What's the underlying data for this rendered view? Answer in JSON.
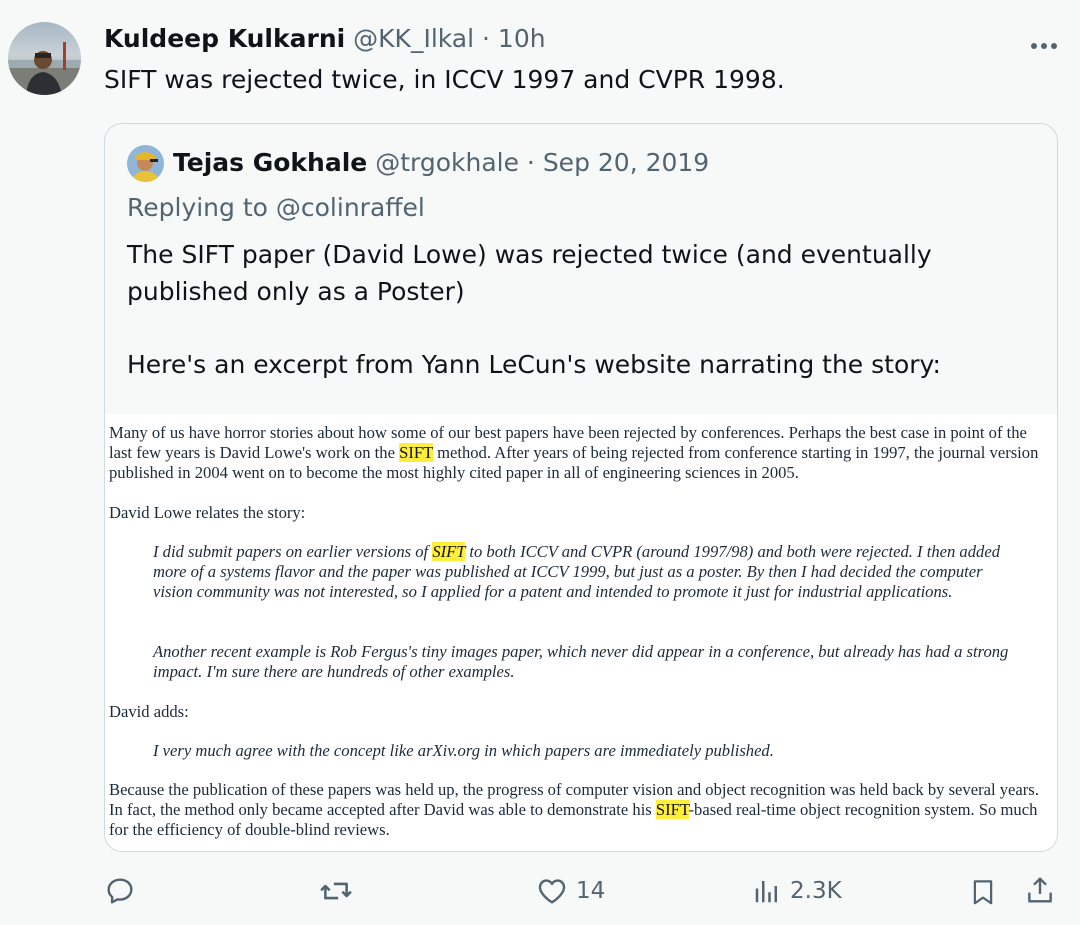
{
  "tweet": {
    "author_name": "Kuldeep Kulkarni",
    "author_handle": "@KK_Ilkal",
    "separator": " · ",
    "time": "10h",
    "text": "SIFT was rejected twice, in ICCV 1997 and CVPR 1998.",
    "more_icon": "more-horizontal-icon"
  },
  "quote": {
    "author_name": "Tejas Gokhale",
    "author_handle": "@trgokhale",
    "separator": " · ",
    "date": "Sep 20, 2019",
    "replying_prefix": "Replying to ",
    "replying_to": "@colinraffel",
    "paragraphs": [
      "The SIFT paper (David Lowe) was rejected twice (and eventually published only as a Poster)",
      "Here's an excerpt from Yann LeCun's website narrating the story:"
    ]
  },
  "excerpt": {
    "highlight_color": "#ffef3a",
    "p1_before": "Many of us have horror stories about how some of our best papers have been rejected by conferences. Perhaps the best case in point of the last few years is David Lowe's work on the ",
    "p1_hl": "SIFT",
    "p1_after": " method. After years of being rejected from conference starting in 1997, the journal version published in 2004 went on to become the most highly cited paper in all of engineering sciences in 2005.",
    "p2": "David Lowe relates the story:",
    "p3_before": "I did submit papers on earlier versions of ",
    "p3_hl": "SIFT",
    "p3_after": " to both ICCV and CVPR (around 1997/98) and both were rejected. I then added more of a systems flavor and the paper was published at ICCV 1999, but just as a poster. By then I had decided the computer vision community was not interested, so I applied for a patent and intended to promote it just for industrial applications.",
    "p4": "Another recent example is Rob Fergus's tiny images paper, which never did appear in a conference, but already has had a strong impact. I'm sure there are hundreds of other examples.",
    "p5": "David adds:",
    "p6": "I very much agree with the concept like arXiv.org in which papers are immediately published.",
    "p7_before": "Because the publication of these papers was held up, the progress of computer vision and object recognition was held back by several years. In fact, the method only became accepted after David was able to demonstrate his ",
    "p7_hl": "SIFT",
    "p7_after": "-based real-time object recognition system. So much for the efficiency of double-blind reviews."
  },
  "actions": {
    "reply_icon": "reply-icon",
    "retweet_icon": "retweet-icon",
    "like_icon": "heart-icon",
    "likes": "14",
    "views_icon": "views-icon",
    "views": "2.3K",
    "bookmark_icon": "bookmark-icon",
    "share_icon": "share-icon"
  }
}
